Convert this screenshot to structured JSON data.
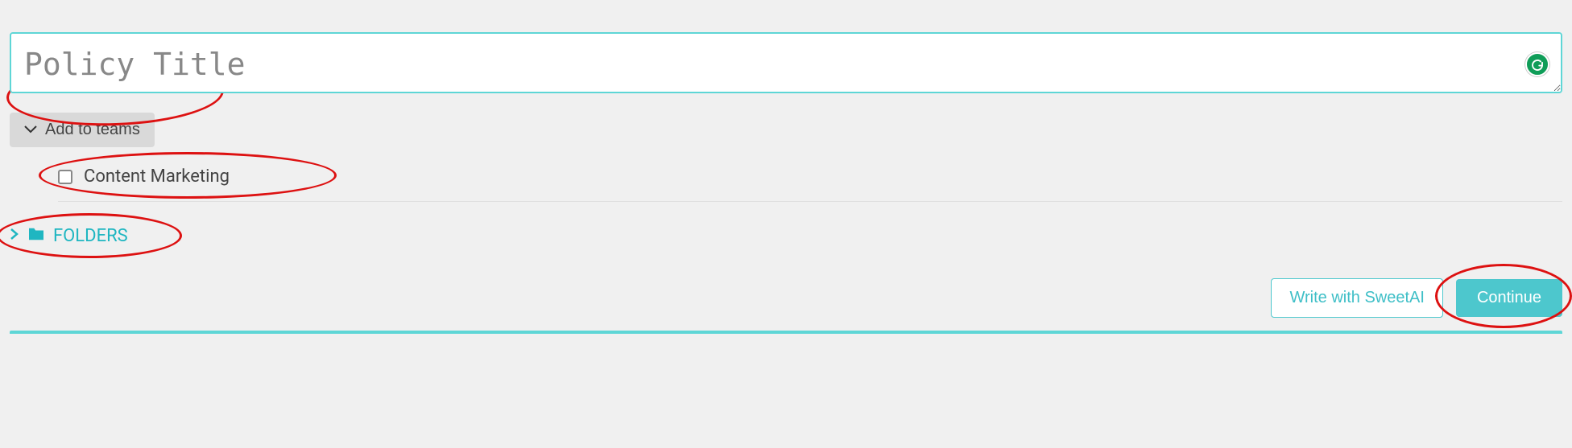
{
  "policyTitle": {
    "placeholder": "Policy Title",
    "value": ""
  },
  "teamsToggle": {
    "label": "Add to teams"
  },
  "teams": [
    {
      "label": "Content Marketing",
      "checked": false
    }
  ],
  "foldersSection": {
    "label": "FOLDERS"
  },
  "actions": {
    "writeWithAI": "Write with SweetAI",
    "continue": "Continue"
  },
  "colors": {
    "accent": "#4dc7cd",
    "annotation": "#d11"
  }
}
